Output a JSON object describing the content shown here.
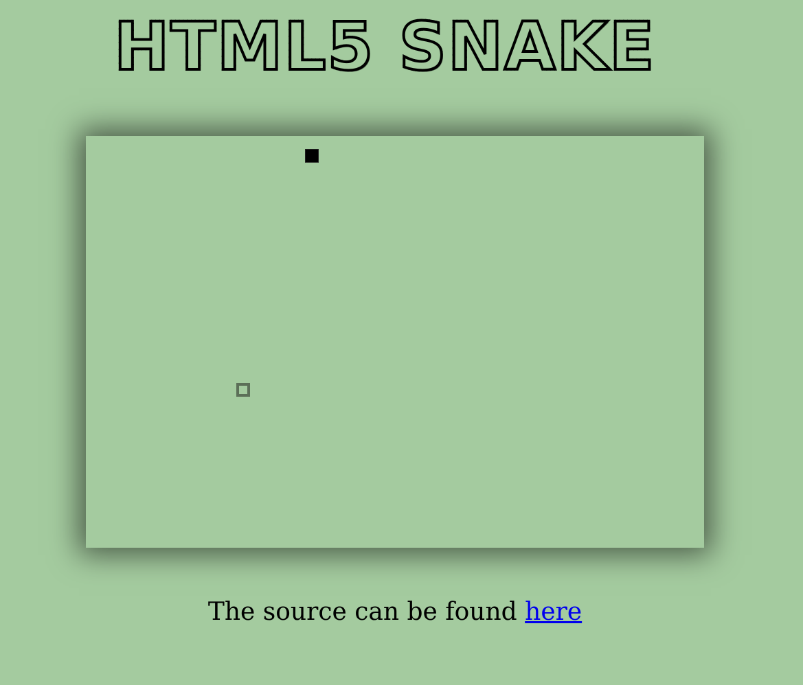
{
  "page": {
    "title": "HTML5 SNAKE"
  },
  "game": {
    "snake_color": "#000000",
    "food_color": "#5c6f58",
    "board_color": "#a4cb9f"
  },
  "footer": {
    "text": "The source can be found ",
    "link_label": "here"
  }
}
